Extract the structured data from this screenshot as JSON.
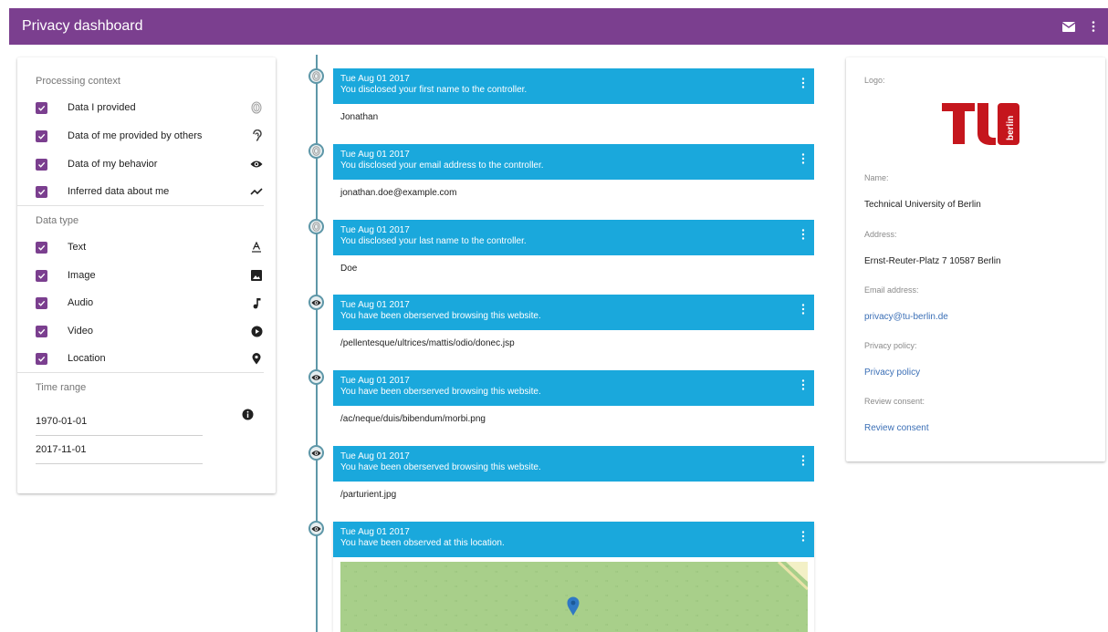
{
  "appbar": {
    "title": "Privacy dashboard",
    "mail_icon": "mail-icon",
    "more_icon": "more-vert-icon"
  },
  "filters": {
    "processing_context": {
      "title": "Processing context",
      "items": [
        {
          "label": "Data I provided",
          "icon": "fingerprint-icon"
        },
        {
          "label": "Data of me provided by others",
          "icon": "hearing-icon"
        },
        {
          "label": "Data of my behavior",
          "icon": "eye-icon"
        },
        {
          "label": "Inferred data about me",
          "icon": "trending-icon"
        }
      ]
    },
    "data_type": {
      "title": "Data type",
      "items": [
        {
          "label": "Text",
          "icon": "text-format-icon"
        },
        {
          "label": "Image",
          "icon": "image-icon"
        },
        {
          "label": "Audio",
          "icon": "music-note-icon"
        },
        {
          "label": "Video",
          "icon": "play-circle-icon"
        },
        {
          "label": "Location",
          "icon": "location-pin-icon"
        }
      ]
    },
    "time_range": {
      "title": "Time range",
      "from": "1970-01-01",
      "to": "2017-11-01",
      "info_icon": "info-icon"
    }
  },
  "timeline": [
    {
      "date": "Tue Aug 01 2017",
      "message": "You disclosed your first name to the controller.",
      "value": "Jonathan",
      "node_icon": "fingerprint-icon"
    },
    {
      "date": "Tue Aug 01 2017",
      "message": "You disclosed your email address to the controller.",
      "value": "jonathan.doe@example.com",
      "node_icon": "fingerprint-icon"
    },
    {
      "date": "Tue Aug 01 2017",
      "message": "You disclosed your last name to the controller.",
      "value": "Doe",
      "node_icon": "fingerprint-icon"
    },
    {
      "date": "Tue Aug 01 2017",
      "message": "You have been oberserved browsing this website.",
      "value": "/pellentesque/ultrices/mattis/odio/donec.jsp",
      "node_icon": "eye-icon"
    },
    {
      "date": "Tue Aug 01 2017",
      "message": "You have been oberserved browsing this website.",
      "value": "/ac/neque/duis/bibendum/morbi.png",
      "node_icon": "eye-icon"
    },
    {
      "date": "Tue Aug 01 2017",
      "message": "You have been oberserved browsing this website.",
      "value": "/parturient.jpg",
      "node_icon": "eye-icon"
    },
    {
      "date": "Tue Aug 01 2017",
      "message": "You have been observed at this location.",
      "value": "",
      "node_icon": "eye-icon"
    }
  ],
  "controller": {
    "logo_label": "Logo:",
    "logo_text": "berlin",
    "name_label": "Name:",
    "name": "Technical University of Berlin",
    "address_label": "Address:",
    "address": "Ernst-Reuter-Platz 7 10587 Berlin",
    "email_label": "Email address:",
    "email": "privacy@tu-berlin.de",
    "policy_label": "Privacy policy:",
    "policy_link": "Privacy policy",
    "consent_label": "Review consent:",
    "consent_link": "Review consent"
  },
  "colors": {
    "appbar": "#7b3f8f",
    "accent": "#1aa8dc",
    "checkbox": "#7b3f8f",
    "timeline": "#5e97a8",
    "link": "#3b6fb6",
    "logo": "#c5161d"
  }
}
